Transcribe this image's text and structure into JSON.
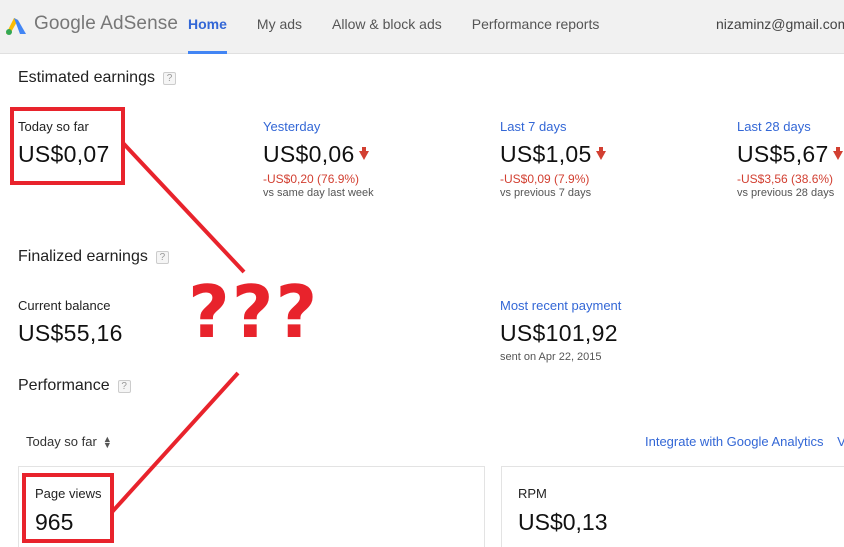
{
  "header": {
    "brand": "Google AdSense",
    "nav": [
      {
        "label": "Home",
        "active": true
      },
      {
        "label": "My ads",
        "active": false
      },
      {
        "label": "Allow & block ads",
        "active": false
      },
      {
        "label": "Performance reports",
        "active": false
      }
    ],
    "account": "nizaminz@gmail.com"
  },
  "estimated": {
    "title": "Estimated earnings",
    "help": "?",
    "today": {
      "label": "Today so far",
      "value": "US$0,07"
    },
    "yesterday": {
      "label": "Yesterday",
      "value": "US$0,06",
      "change": "-US$0,20 (76.9%)",
      "compare": "vs same day last week"
    },
    "last7": {
      "label": "Last 7 days",
      "value": "US$1,05",
      "change": "-US$0,09 (7.9%)",
      "compare": "vs previous 7 days"
    },
    "last28": {
      "label": "Last 28 days",
      "value": "US$5,67",
      "change": "-US$3,56 (38.6%)",
      "compare": "vs previous 28 days"
    }
  },
  "finalized": {
    "title": "Finalized earnings",
    "help": "?",
    "balance": {
      "label": "Current balance",
      "value": "US$55,16"
    },
    "payment": {
      "label": "Most recent payment",
      "value": "US$101,92",
      "date": "sent on Apr 22, 2015"
    }
  },
  "performance": {
    "title": "Performance",
    "help": "?",
    "period": "Today so far",
    "ga_link": "Integrate with Google Analytics",
    "ga_link_cut": "V",
    "cards": [
      {
        "label": "Page views",
        "value": "965"
      },
      {
        "label": "RPM",
        "value": "US$0,13"
      }
    ]
  },
  "annotation": {
    "text": "???",
    "color": "#e8232c"
  },
  "colors": {
    "link": "#3367d6",
    "negative": "#d23f31",
    "header_bg": "#f1f1f1",
    "annotation_red": "#e8232c"
  }
}
